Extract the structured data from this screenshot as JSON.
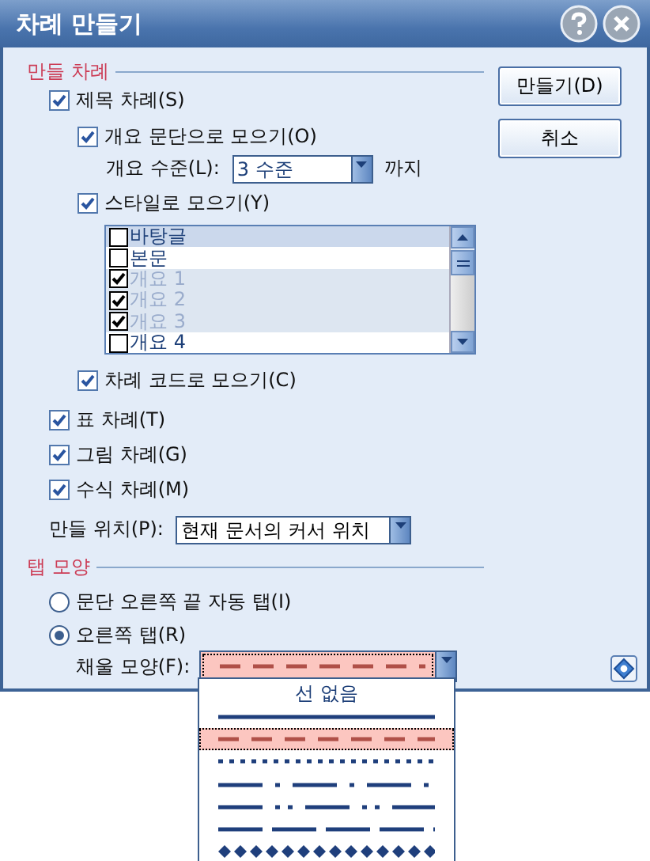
{
  "window": {
    "title": "차례 만들기"
  },
  "toc_section": {
    "title": "만들 차례",
    "heading_toc": {
      "label": "제목 차례(S)",
      "checked": true
    },
    "by_outline": {
      "label": "개요 문단으로 모으기(O)",
      "checked": true
    },
    "outline_level": {
      "label": "개요 수준(L):",
      "value": "3 수준",
      "suffix": "까지"
    },
    "by_style": {
      "label": "스타일로 모으기(Y)",
      "checked": true
    },
    "styles": [
      {
        "label": "바탕글",
        "checked": false,
        "selected": true,
        "disabled": false
      },
      {
        "label": "본문",
        "checked": false,
        "selected": false,
        "disabled": false
      },
      {
        "label": "개요 1",
        "checked": true,
        "selected": false,
        "disabled": true
      },
      {
        "label": "개요 2",
        "checked": true,
        "selected": false,
        "disabled": true
      },
      {
        "label": "개요 3",
        "checked": true,
        "selected": false,
        "disabled": true
      },
      {
        "label": "개요 4",
        "checked": false,
        "selected": false,
        "disabled": false
      }
    ],
    "by_code": {
      "label": "차례 코드로 모으기(C)",
      "checked": true
    },
    "others": [
      {
        "label": "표 차례(T)",
        "checked": true
      },
      {
        "label": "그림 차례(G)",
        "checked": true
      },
      {
        "label": "수식 차례(M)",
        "checked": true
      }
    ],
    "location": {
      "label": "만들 위치(P):",
      "value": "현재 문서의 커서 위치"
    }
  },
  "tab_section": {
    "title": "탭 모양",
    "options": [
      {
        "label": "문단 오른쪽 끝 자동 탭(I)",
        "selected": false
      },
      {
        "label": "오른쪽 탭(R)",
        "selected": true
      }
    ],
    "fill": {
      "label": "채울 모양(F):",
      "kind": "dash"
    }
  },
  "buttons": [
    {
      "label": "만들기(D)"
    },
    {
      "label": "취소"
    }
  ],
  "fill_dropdown": {
    "items": [
      {
        "kind": "text",
        "label": "선 없음",
        "selected": false
      },
      {
        "kind": "solid",
        "selected": false
      },
      {
        "kind": "dash",
        "selected": true
      },
      {
        "kind": "dot",
        "selected": false
      },
      {
        "kind": "dashdot",
        "selected": false
      },
      {
        "kind": "dashdotdot",
        "selected": false
      },
      {
        "kind": "longdash",
        "selected": false
      },
      {
        "kind": "diamond",
        "selected": false
      }
    ]
  }
}
